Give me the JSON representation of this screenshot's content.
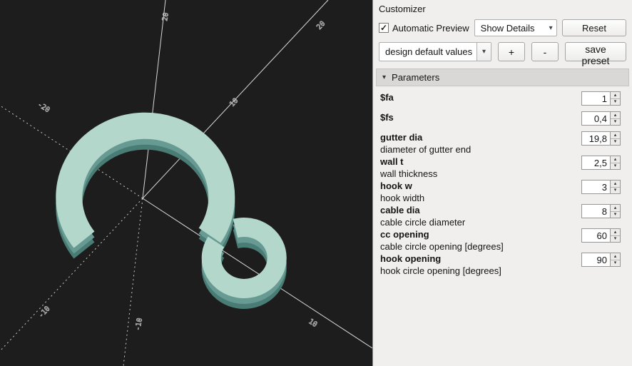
{
  "viewport": {
    "background": "#1d1d1d",
    "axis_color": "#d9d9d9",
    "model_colors": {
      "top": "#b4d7cc",
      "side": "#679a92",
      "shadow": "#497c74"
    },
    "ticks": [
      {
        "label": "20"
      },
      {
        "label": "20"
      },
      {
        "label": "10"
      },
      {
        "label": "-10"
      },
      {
        "label": "-20"
      },
      {
        "label": "-10"
      },
      {
        "label": "-10"
      },
      {
        "label": "10"
      }
    ]
  },
  "icons": {
    "check": "✓",
    "chevron_down": "▾",
    "triangle_down": "▾",
    "spin_up": "▴",
    "spin_down": "▾"
  },
  "panel": {
    "title": "Customizer",
    "automatic_preview": {
      "label": "Automatic Preview",
      "checked": true
    },
    "details_dropdown": {
      "value": "Show Details"
    },
    "reset_button": "Reset",
    "preset_dropdown": {
      "value": "design default values"
    },
    "plus_button": "+",
    "minus_button": "-",
    "save_preset_button": "save preset",
    "parameters_header": "Parameters",
    "parameters": [
      {
        "name": "$fa",
        "desc": "",
        "value": "1"
      },
      {
        "name": "$fs",
        "desc": "",
        "value": "0,4"
      },
      {
        "name": "gutter dia",
        "desc": "diameter of gutter end",
        "value": "19,8"
      },
      {
        "name": "wall t",
        "desc": "wall thickness",
        "value": "2,5"
      },
      {
        "name": "hook w",
        "desc": "hook width",
        "value": "3"
      },
      {
        "name": "cable dia",
        "desc": "cable circle diameter",
        "value": "8"
      },
      {
        "name": "cc opening",
        "desc": "cable circle opening [degrees]",
        "value": "60"
      },
      {
        "name": "hook opening",
        "desc": "hook circle opening [degrees]",
        "value": "90"
      }
    ]
  }
}
